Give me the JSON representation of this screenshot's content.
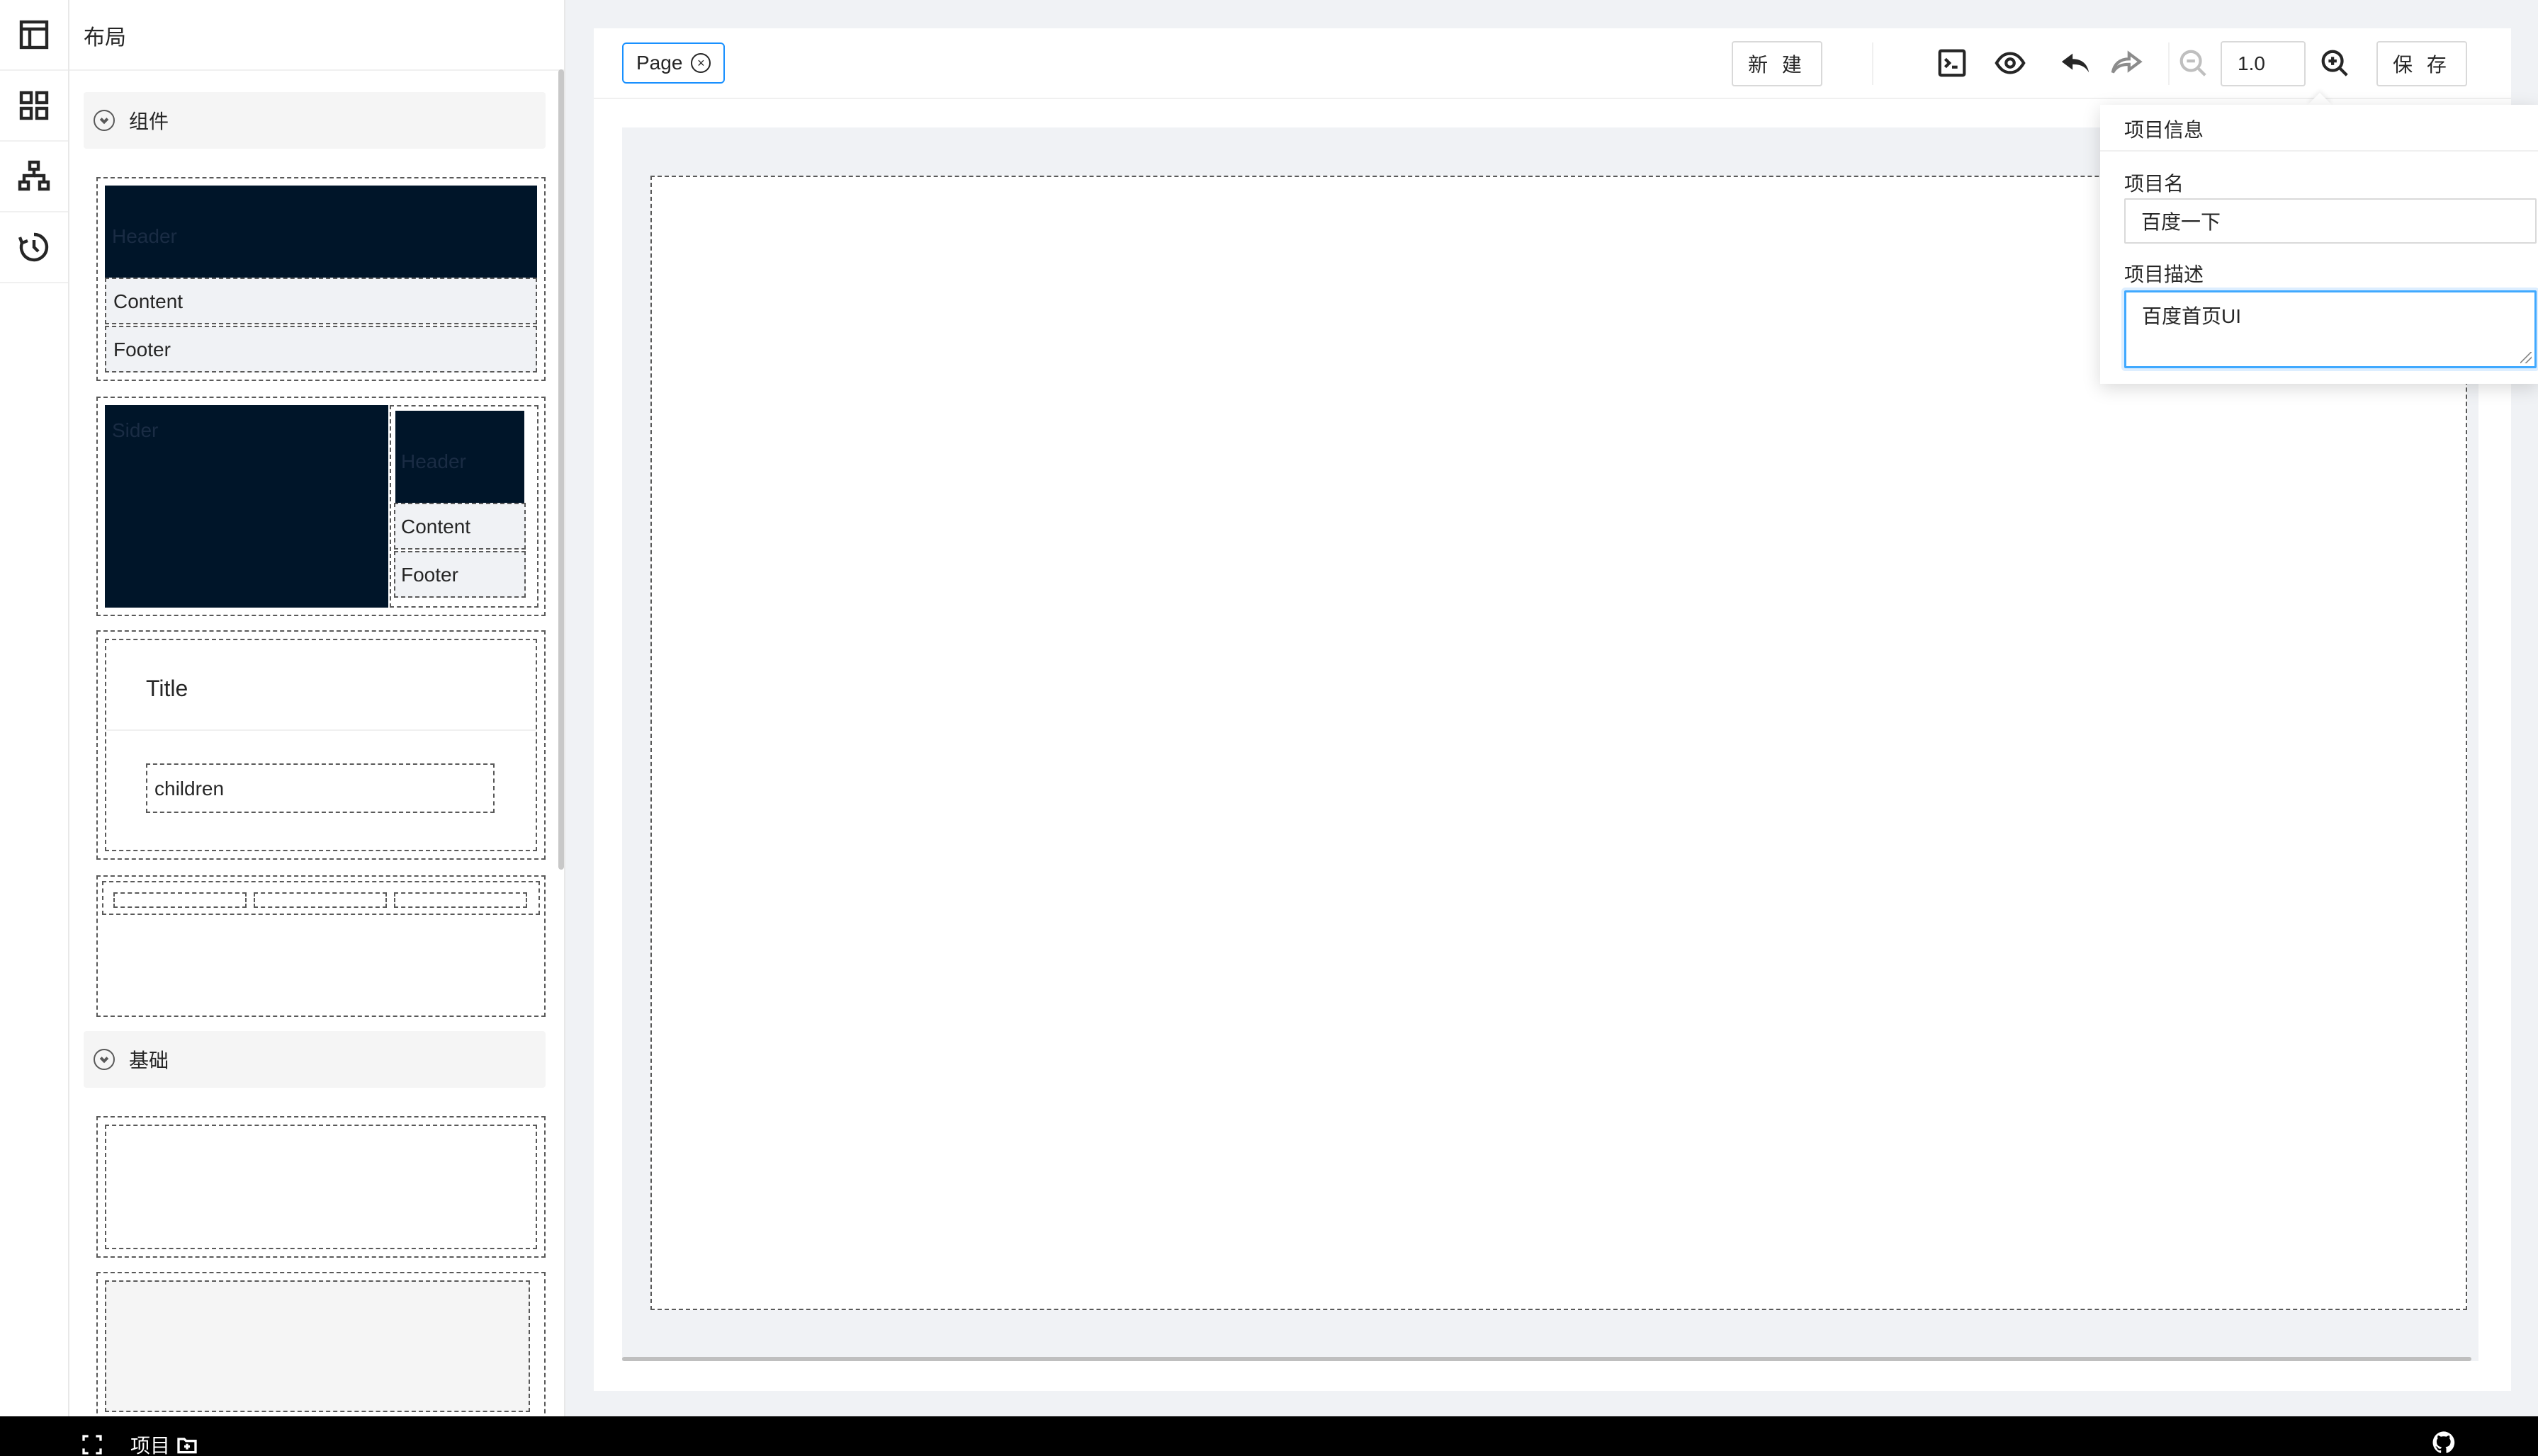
{
  "sidebar": {
    "panel_title": "布局",
    "rail_icons": [
      "layout-icon",
      "components-grid-icon",
      "tree-structure-icon",
      "history-icon"
    ]
  },
  "components": {
    "section_label": "组件",
    "layout1": {
      "header": "Header",
      "content": "Content",
      "footer": "Footer"
    },
    "layout2": {
      "sider": "Sider",
      "header": "Header",
      "content": "Content",
      "footer": "Footer"
    },
    "card": {
      "title": "Title",
      "children": "children"
    }
  },
  "basics": {
    "section_label": "基础"
  },
  "toolbar": {
    "tab_label": "Page",
    "new_label": "新 建",
    "zoom_value": "1.0",
    "save_label": "保 存"
  },
  "project_popover": {
    "title": "项目信息",
    "name_label": "项目名",
    "name_value": "百度一下",
    "desc_label": "项目描述",
    "desc_value": "百度首页UI"
  },
  "statusbar": {
    "project_label": "项目"
  },
  "colors": {
    "accent": "#1890ff",
    "dark_layout": "#001529",
    "canvas_bg": "#f0f2f5"
  }
}
